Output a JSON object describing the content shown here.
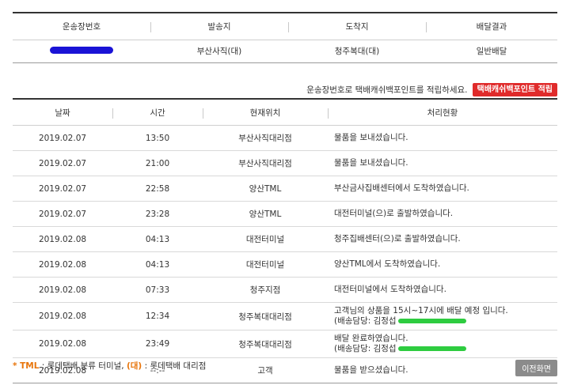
{
  "summary": {
    "headers": [
      "운송장번호",
      "발송지",
      "도착지",
      "배달결과"
    ],
    "row": {
      "origin": "부산사직(대)",
      "destination": "청주복대(대)",
      "result": "일반배달"
    }
  },
  "point": {
    "text": "운송장번호로 택배캐쉬백포인트를 적립하세요.",
    "button": "택배캐쉬백포인트 적립"
  },
  "tracking": {
    "headers": [
      "날짜",
      "시간",
      "현재위치",
      "처리현황"
    ],
    "rows": [
      {
        "date": "2019.02.07",
        "time": "13:50",
        "location": "부산사직대리점",
        "status": "물품을 보내셨습니다."
      },
      {
        "date": "2019.02.07",
        "time": "21:00",
        "location": "부산사직대리점",
        "status": "물품을 보내셨습니다."
      },
      {
        "date": "2019.02.07",
        "time": "22:58",
        "location": "양산TML",
        "status": "부산금사집배센터에서 도착하였습니다."
      },
      {
        "date": "2019.02.07",
        "time": "23:28",
        "location": "양산TML",
        "status": "대전터미널(으)로 출발하였습니다."
      },
      {
        "date": "2019.02.08",
        "time": "04:13",
        "location": "대전터미널",
        "status": "청주집배센터(으)로 출발하였습니다."
      },
      {
        "date": "2019.02.08",
        "time": "04:13",
        "location": "대전터미널",
        "status": "양산TML에서 도착하였습니다."
      },
      {
        "date": "2019.02.08",
        "time": "07:33",
        "location": "청주지점",
        "status": "대전터미널에서 도착하였습니다."
      },
      {
        "date": "2019.02.08",
        "time": "12:34",
        "location": "청주복대대리점",
        "status": "고객님의 상품을 15시~17시에 배달 예정 입니다.",
        "courier": "(배송담당: 김정섭"
      },
      {
        "date": "2019.02.08",
        "time": "23:49",
        "location": "청주복대대리점",
        "status": "배달 완료하였습니다.",
        "courier": "(배송담당: 김정섭"
      },
      {
        "date": "2019.02.08",
        "time": "--:--",
        "location": "고객",
        "status": "물품을 받으셨습니다."
      }
    ]
  },
  "legend": {
    "prefix": "* TML",
    "tml_desc": " : 롯데택배 분류 터미널, ",
    "dae": "(대)",
    "dae_desc": " : 롯데택배 대리점"
  },
  "prev_button": "이전화면",
  "colors": {
    "accent_red": "#e02b2b",
    "orange": "#e8750b",
    "scribble_blue": "#1a13d6",
    "scribble_green": "#2ecc40"
  }
}
